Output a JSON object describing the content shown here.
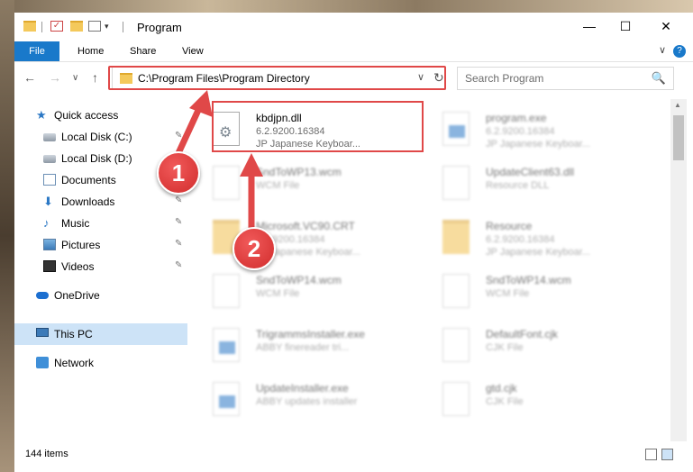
{
  "window": {
    "title": "Program",
    "minimize": "—",
    "maximize": "☐",
    "close": "✕"
  },
  "ribbon": {
    "tabs": [
      "File",
      "Home",
      "Share",
      "View"
    ],
    "help": "?",
    "collapse": "∨"
  },
  "nav": {
    "back": "←",
    "forward": "→",
    "recent": "∨",
    "up": "↑",
    "address": "C:\\Program Files\\Program Directory",
    "address_dropdown": "∨",
    "refresh": "↻",
    "search_placeholder": "Search Program",
    "search_icon": "🔍"
  },
  "sidebar": {
    "items": [
      {
        "label": "Quick access",
        "icon": "star-icon"
      },
      {
        "label": "Local Disk (C:)",
        "icon": "disk-icon",
        "pinned": true
      },
      {
        "label": "Local Disk (D:)",
        "icon": "disk-icon"
      },
      {
        "label": "Documents",
        "icon": "documents-icon",
        "pinned": true
      },
      {
        "label": "Downloads",
        "icon": "download-icon",
        "pinned": true
      },
      {
        "label": "Music",
        "icon": "music-icon",
        "pinned": true
      },
      {
        "label": "Pictures",
        "icon": "pictures-icon",
        "pinned": true
      },
      {
        "label": "Videos",
        "icon": "videos-icon",
        "pinned": true
      },
      {
        "label": "OneDrive",
        "icon": "cloud-icon"
      },
      {
        "label": "This PC",
        "icon": "pc-icon",
        "selected": true
      },
      {
        "label": "Network",
        "icon": "network-icon"
      }
    ],
    "pin_glyph": "📌"
  },
  "files": [
    {
      "name": "kbdjpn.dll",
      "line1": "6.2.9200.16384",
      "line2": "JP Japanese Keyboar...",
      "icon": "dll",
      "highlight": true
    },
    {
      "name": "program.exe",
      "line1": "6.2.9200.16384",
      "line2": "JP Japanese Keyboar...",
      "icon": "exe"
    },
    {
      "name": "SndToWP13.wcm",
      "line1": "WCM File",
      "line2": "",
      "icon": "doc"
    },
    {
      "name": "UpdateClient63.dll",
      "line1": "Resource DLL",
      "line2": "",
      "icon": "doc"
    },
    {
      "name": "Microsoft.VC90.CRT",
      "line1": "6.2.9200.16384",
      "line2": "JP Japanese Keyboar...",
      "icon": "folder"
    },
    {
      "name": "Resource",
      "line1": "6.2.9200.16384",
      "line2": "JP Japanese Keyboar...",
      "icon": "folder"
    },
    {
      "name": "SndToWP14.wcm",
      "line1": "WCM File",
      "line2": "",
      "icon": "doc"
    },
    {
      "name": "SndToWP14.wcm",
      "line1": "WCM File",
      "line2": "",
      "icon": "doc"
    },
    {
      "name": "TrigrammsInstaller.exe",
      "line1": "ABBY finereader tri...",
      "line2": "",
      "icon": "exe"
    },
    {
      "name": "DefaultFont.cjk",
      "line1": "CJK File",
      "line2": "",
      "icon": "doc"
    },
    {
      "name": "UpdateInstaller.exe",
      "line1": "ABBY updates installer",
      "line2": "",
      "icon": "exe"
    },
    {
      "name": "gtd.cjk",
      "line1": "CJK File",
      "line2": "",
      "icon": "doc"
    }
  ],
  "status": {
    "count": "144 items"
  },
  "annotations": {
    "step1": "1",
    "step2": "2",
    "color": "#e04848"
  }
}
